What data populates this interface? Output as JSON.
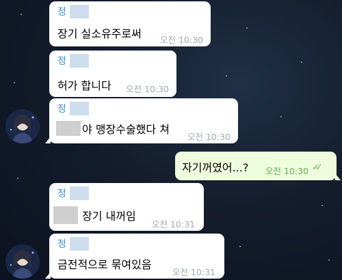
{
  "messages": [
    {
      "sender": "정",
      "text": "장기 실소유주로써",
      "time": "오전 10:30"
    },
    {
      "sender": "정",
      "text": "허가 합니다",
      "time": "오전 10:30"
    },
    {
      "sender": "정",
      "text": "야 맹장수술했다 쳐",
      "time": "오전 10:30"
    },
    {
      "text": "자기꺼였어...?",
      "time": "오전 10:30",
      "status_icon": "double-check-icon"
    },
    {
      "sender": "정",
      "text": "장기 내꺼임",
      "time": "오전 10:31"
    },
    {
      "sender": "정",
      "text": "금전적으로 묶여있음",
      "time": "오전 10:31"
    }
  ],
  "colors": {
    "incoming_bubble": "#ffffff",
    "outgoing_bubble": "#effdde",
    "sender_name": "#3a8fd0",
    "read_check": "#5eae4f",
    "background": "#141d2c"
  }
}
